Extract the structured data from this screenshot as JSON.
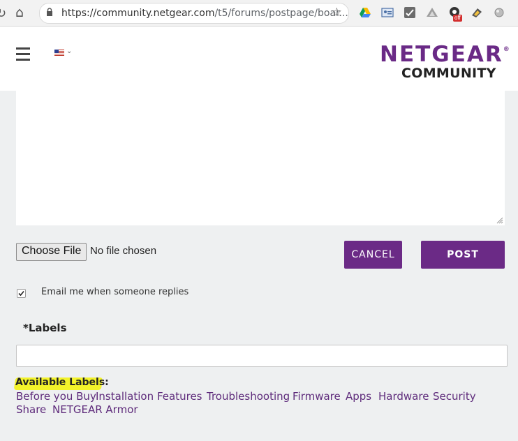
{
  "browser": {
    "url_main": "https://community.netgear.com",
    "url_rest": "/t5/forums/postpage/boar...",
    "extension_icons": [
      "google-drive-icon",
      "photo-extension-icon",
      "checkmark-extension-icon",
      "drive-triangle-icon",
      "tracker-blocker-icon",
      "clipper-icon",
      "circle-extension-icon"
    ],
    "off_badge": "off"
  },
  "header": {
    "logo_brand": "NETGEAR",
    "logo_reg": "®",
    "logo_sub": "COMMUNITY"
  },
  "form": {
    "choose_file_label": "Choose File",
    "no_file_text": "No file chosen",
    "cancel_label": "CANCEL",
    "post_label": "POST",
    "email_opt_label": "Email me when someone replies",
    "email_opt_checked": true,
    "labels_title": "*Labels",
    "labels_input_value": "",
    "available_labels_title": "Available Labels:",
    "available_labels": [
      "Before you Buy",
      "Installation",
      "Features",
      "Troubleshooting",
      "Firmware",
      "Apps",
      "Hardware",
      "Security",
      "Share",
      "NETGEAR Armor"
    ]
  },
  "colors": {
    "brand_purple": "#6b2a86",
    "link_purple": "#5e2b7b",
    "highlight_yellow": "#f3f32a",
    "page_bg": "#eef0f1"
  }
}
